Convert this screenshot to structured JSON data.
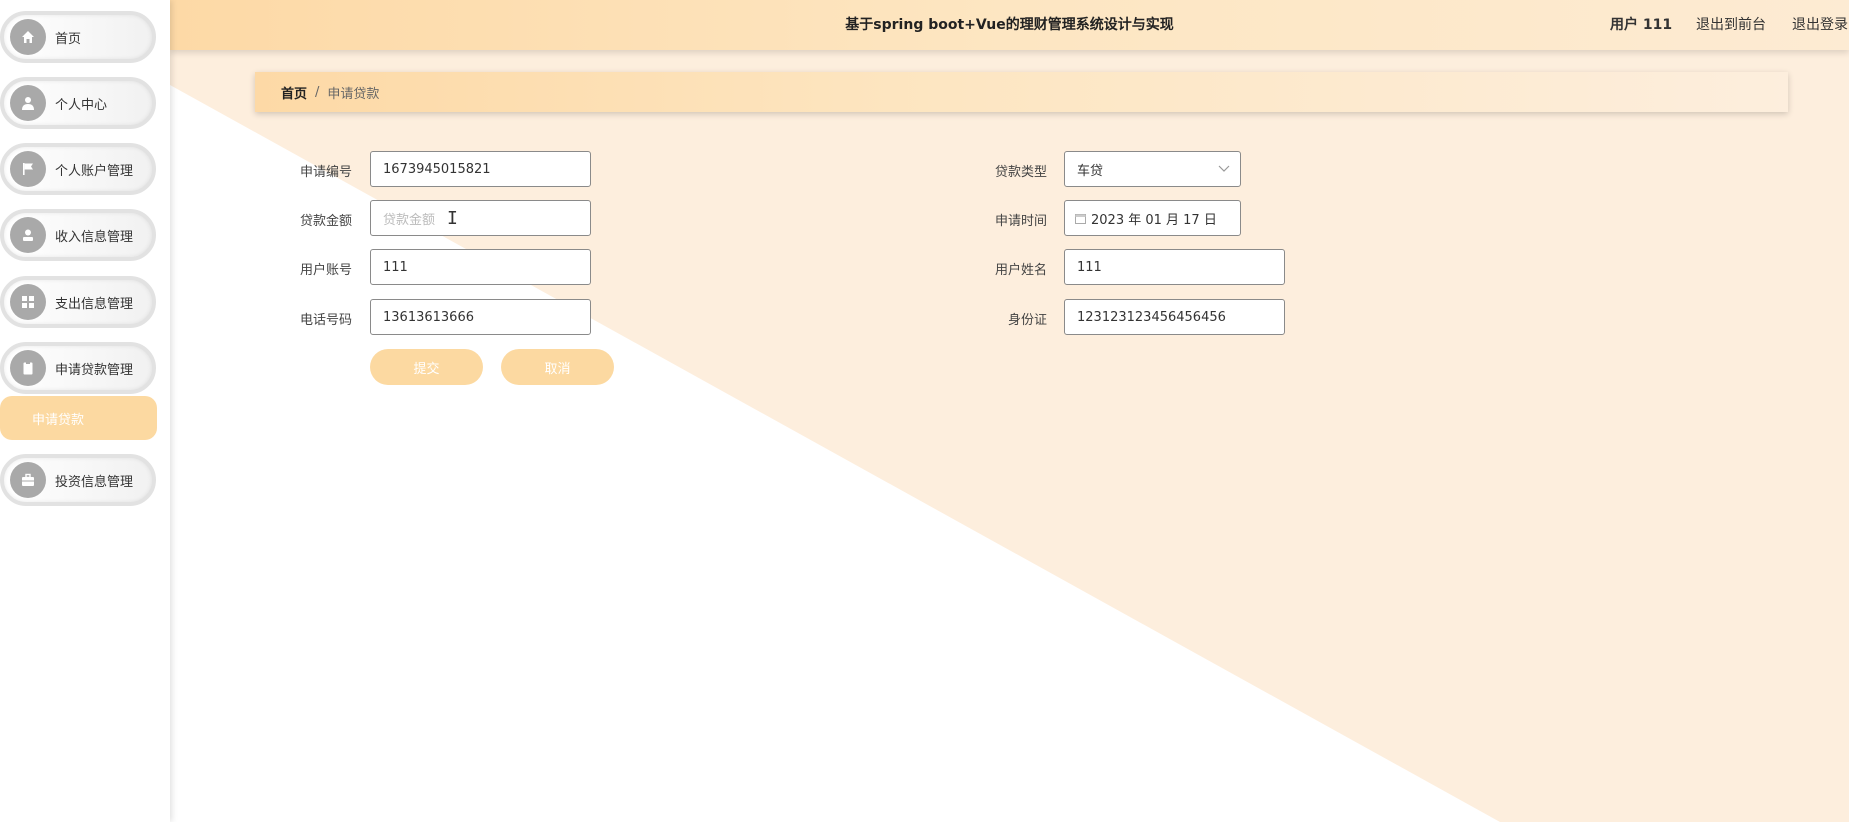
{
  "header": {
    "title": "基于spring boot+Vue的理财管理系统设计与实现",
    "user": "用户 111",
    "links": [
      "退出到前台",
      "退出登录"
    ]
  },
  "sidebar": {
    "items": [
      {
        "label": "首页",
        "icon": "home-icon"
      },
      {
        "label": "个人中心",
        "icon": "user-icon"
      },
      {
        "label": "个人账户管理",
        "icon": "flag-icon"
      },
      {
        "label": "收入信息管理",
        "icon": "user-card-icon"
      },
      {
        "label": "支出信息管理",
        "icon": "grid-icon"
      },
      {
        "label": "申请贷款管理",
        "icon": "clipboard-icon"
      },
      {
        "label": "投资信息管理",
        "icon": "briefcase-icon"
      }
    ],
    "submenu": {
      "label": "申请贷款"
    }
  },
  "breadcrumb": {
    "home": "首页",
    "separator": "/",
    "current": "申请贷款"
  },
  "form": {
    "left": [
      {
        "label": "申请编号",
        "value": "1673945015821"
      },
      {
        "label": "贷款金额",
        "value": "",
        "placeholder": "贷款金额"
      },
      {
        "label": "用户账号",
        "value": "111"
      },
      {
        "label": "电话号码",
        "value": "13613613666"
      }
    ],
    "right": [
      {
        "label": "贷款类型",
        "value": "车贷"
      },
      {
        "label": "申请时间",
        "value": "2023 年 01 月 17 日"
      },
      {
        "label": "用户姓名",
        "value": "111"
      },
      {
        "label": "身份证",
        "value": "123123123456456456"
      }
    ],
    "buttons": {
      "submit": "提交",
      "cancel": "取消"
    }
  },
  "colors": {
    "accent": "#fcd9a1",
    "header_gradient_start": "#fdd9a6",
    "background_shape": "#fdeedd"
  }
}
